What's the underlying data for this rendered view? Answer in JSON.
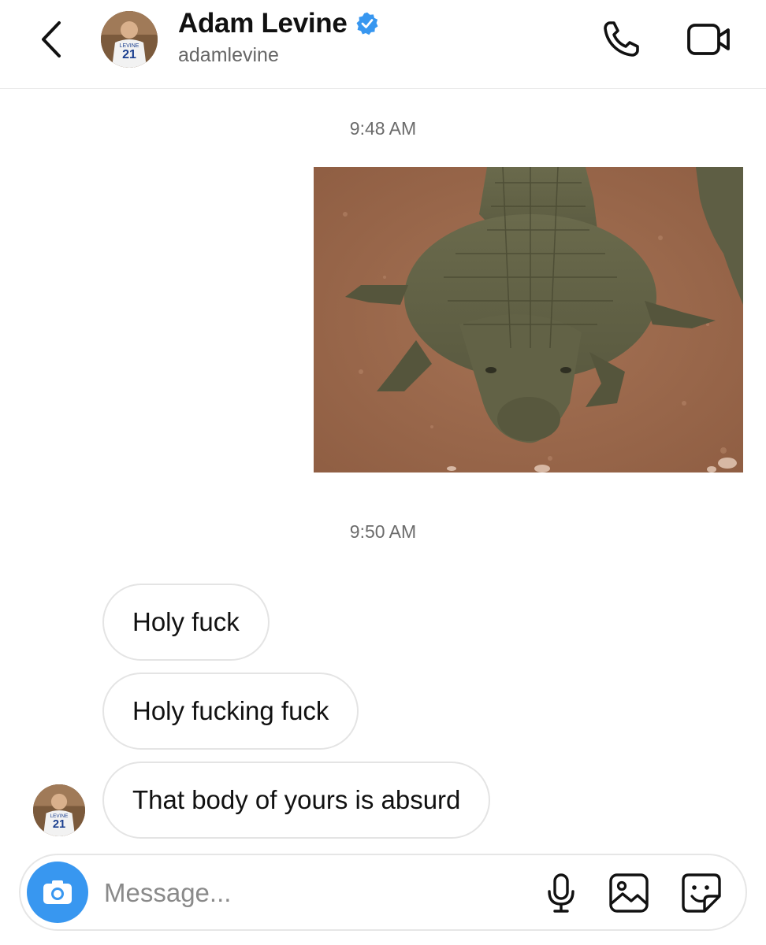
{
  "header": {
    "contact_name": "Adam Levine",
    "handle": "adamlevine",
    "verified": true,
    "icons": {
      "back": "chevron-left-icon",
      "call": "phone-icon",
      "video": "video-camera-icon"
    }
  },
  "thread": {
    "timestamp_1": "9:48 AM",
    "photo": {
      "description_icon": "image-crocodile"
    },
    "timestamp_2": "9:50 AM",
    "messages": [
      {
        "text": "Holy fuck"
      },
      {
        "text": "Holy fucking fuck"
      },
      {
        "text": "That body of yours is absurd"
      }
    ]
  },
  "composer": {
    "placeholder": "Message...",
    "icons": {
      "camera": "camera-icon",
      "mic": "microphone-icon",
      "gallery": "image-icon",
      "sticker": "sticker-icon"
    }
  },
  "colors": {
    "accent": "#3897f0",
    "verified": "#3897f0",
    "bubble_border": "#e4e4e4",
    "timestamp": "#6b6b6b"
  }
}
